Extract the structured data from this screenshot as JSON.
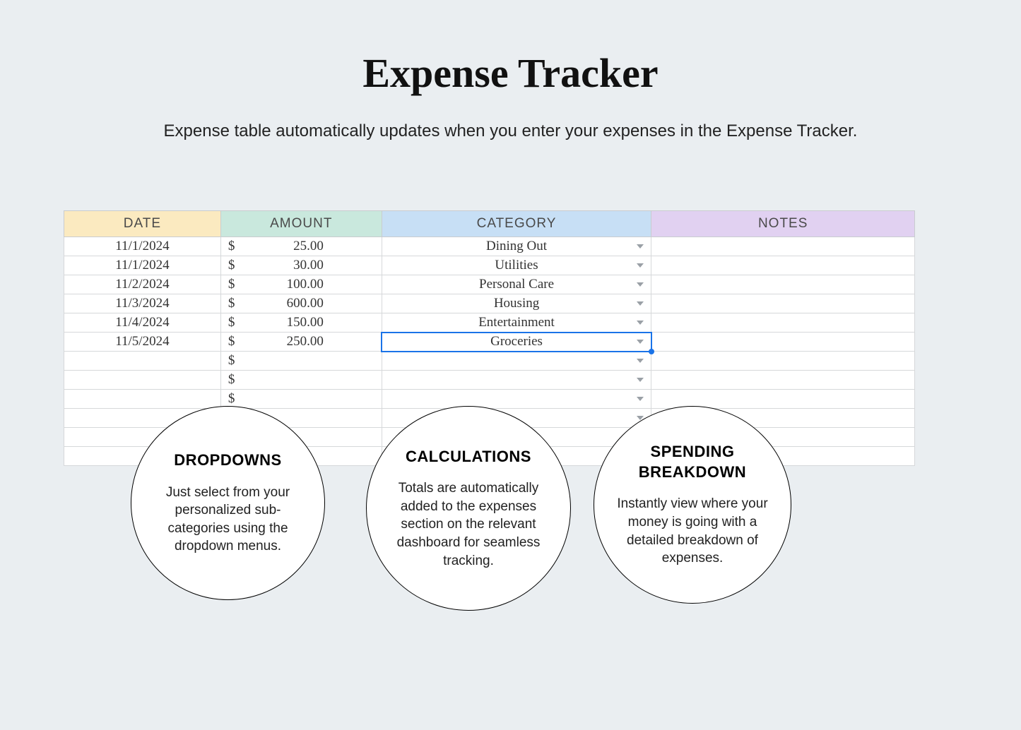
{
  "title": "Expense Tracker",
  "subtitle": "Expense table automatically updates when you enter your expenses in the Expense Tracker.",
  "headers": {
    "date": "DATE",
    "amount": "AMOUNT",
    "category": "CATEGORY",
    "notes": "NOTES"
  },
  "rows": [
    {
      "date": "11/1/2024",
      "amount": "25.00",
      "category": "Dining Out",
      "notes": ""
    },
    {
      "date": "11/1/2024",
      "amount": "30.00",
      "category": "Utilities",
      "notes": ""
    },
    {
      "date": "11/2/2024",
      "amount": "100.00",
      "category": "Personal Care",
      "notes": ""
    },
    {
      "date": "11/3/2024",
      "amount": "600.00",
      "category": "Housing",
      "notes": ""
    },
    {
      "date": "11/4/2024",
      "amount": "150.00",
      "category": "Entertainment",
      "notes": ""
    },
    {
      "date": "11/5/2024",
      "amount": "250.00",
      "category": "Groceries",
      "notes": ""
    },
    {
      "date": "",
      "amount": "",
      "category": "",
      "notes": ""
    },
    {
      "date": "",
      "amount": "",
      "category": "",
      "notes": ""
    },
    {
      "date": "",
      "amount": "",
      "category": "",
      "notes": ""
    },
    {
      "date": "",
      "amount": "",
      "category": "",
      "notes": ""
    },
    {
      "date": "",
      "amount": "",
      "category": "",
      "notes": ""
    },
    {
      "date": "",
      "amount": "",
      "category": "",
      "notes": ""
    }
  ],
  "selected_row_index": 5,
  "callouts": {
    "c1": {
      "title": "DROPDOWNS",
      "body": "Just select from your personalized sub-categories using the dropdown menus."
    },
    "c2": {
      "title": "CALCULATIONS",
      "body": "Totals are automatically added to the expenses section on the relevant dashboard for seamless tracking."
    },
    "c3": {
      "title": "SPENDING BREAKDOWN",
      "body": "Instantly view where your money is going with a detailed breakdown of expenses."
    }
  }
}
